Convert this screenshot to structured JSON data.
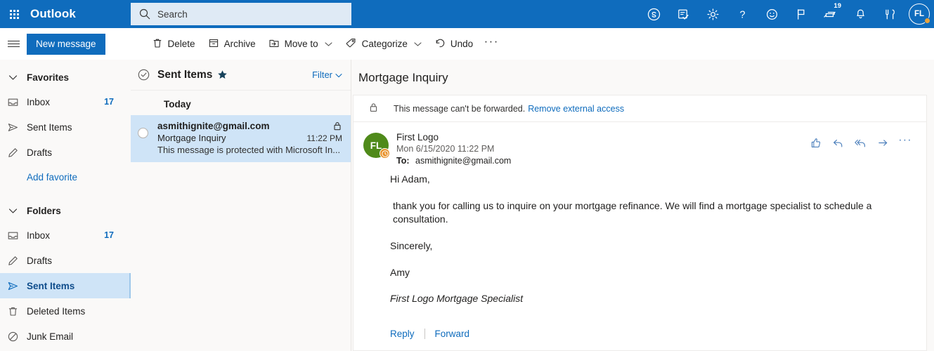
{
  "topbar": {
    "app_grid_icon": "waffle-icon",
    "brand": "Outlook",
    "search": {
      "icon": "search-icon",
      "placeholder": "Search",
      "value": ""
    },
    "icons": [
      {
        "name": "skype-icon",
        "label": "Skype"
      },
      {
        "name": "tasks-checklist-icon",
        "label": "To Do"
      },
      {
        "name": "gear-icon",
        "label": "Settings"
      },
      {
        "name": "question-mark-icon",
        "label": "Help"
      },
      {
        "name": "smiley-face-icon",
        "label": "Feedback"
      },
      {
        "name": "flag-icon",
        "label": "Flagged"
      },
      {
        "name": "chat-bubble-icon",
        "label": "Messages",
        "badge": "19"
      },
      {
        "name": "bell-icon",
        "label": "Notifications"
      },
      {
        "name": "utensils-icon",
        "label": "Lunch"
      }
    ],
    "message_badge": "19",
    "avatar_initials": "FL"
  },
  "commandbar": {
    "menu_icon": "hamburger-icon",
    "new_message": "New message",
    "actions": [
      {
        "label": "Delete",
        "icon": "trash-icon",
        "chevron": false
      },
      {
        "label": "Archive",
        "icon": "archive-box-icon",
        "chevron": false
      },
      {
        "label": "Move to",
        "icon": "move-to-folder-icon",
        "chevron": true
      },
      {
        "label": "Categorize",
        "icon": "tag-icon",
        "chevron": true
      },
      {
        "label": "Undo",
        "icon": "undo-arrow-icon",
        "chevron": false
      }
    ],
    "overflow": "···"
  },
  "sidebar": {
    "favorites": {
      "label": "Favorites",
      "chevron_icon": "chevron-down-icon",
      "items": [
        {
          "label": "Inbox",
          "icon": "inbox-icon",
          "count": "17"
        },
        {
          "label": "Sent Items",
          "icon": "sent-paper-plane-icon",
          "count": ""
        },
        {
          "label": "Drafts",
          "icon": "pencil-icon",
          "count": ""
        }
      ],
      "add_favorite": "Add favorite"
    },
    "folders": {
      "label": "Folders",
      "chevron_icon": "chevron-down-icon",
      "items": [
        {
          "label": "Inbox",
          "icon": "inbox-icon",
          "count": "17",
          "selected": false
        },
        {
          "label": "Drafts",
          "icon": "pencil-icon",
          "count": "",
          "selected": false
        },
        {
          "label": "Sent Items",
          "icon": "sent-paper-plane-icon",
          "count": "",
          "selected": true
        },
        {
          "label": "Deleted Items",
          "icon": "trash-icon",
          "count": "",
          "selected": false
        },
        {
          "label": "Junk Email",
          "icon": "no-entry-icon",
          "count": "",
          "selected": false
        }
      ]
    }
  },
  "messagelist": {
    "select_all_icon": "check-circle-icon",
    "title": "Sent Items",
    "star_icon": "star-filled-icon",
    "filter_label": "Filter",
    "filter_chevron": "chevron-down-icon",
    "day_group": "Today",
    "items": [
      {
        "sender": "asmithignite@gmail.com",
        "subject": "Mortgage Inquiry",
        "time": "11:22 PM",
        "preview": "This message is protected with Microsoft In...",
        "lock_icon": "lock-icon",
        "select_icon": "circle-icon",
        "selected": true
      }
    ]
  },
  "reading_pane": {
    "subject": "Mortgage Inquiry",
    "notice": {
      "icon": "lock-icon",
      "text": "This message can't be forwarded.",
      "link": "Remove external access"
    },
    "sender": {
      "avatar_initials": "FL",
      "avatar_color": "#4f8a1a",
      "badge_icon": "clock-icon",
      "badge_color": "#e8922b",
      "name": "First Logo",
      "date": "Mon 6/15/2020 11:22 PM",
      "to_label": "To:",
      "to_value": "asmithignite@gmail.com"
    },
    "actions": [
      {
        "name": "thumbs-up-icon",
        "label": "Like"
      },
      {
        "name": "reply-icon",
        "label": "Reply"
      },
      {
        "name": "reply-all-icon",
        "label": "Reply all"
      },
      {
        "name": "forward-arrow-icon",
        "label": "Forward"
      },
      {
        "name": "more-options-icon",
        "label": "···"
      }
    ],
    "body": [
      "Hi Adam,",
      " thank you for calling us to inquire on your mortgage refinance.  We will find a mortgage specialist to schedule a consultation.",
      "Sincerely,",
      "Amy"
    ],
    "signature": "First Logo Mortgage Specialist",
    "footer": {
      "reply": "Reply",
      "forward": "Forward"
    }
  },
  "colors": {
    "brand_blue": "#0f6cbd",
    "selection_blue": "#cfe4f7",
    "link_blue": "#0f6cbd",
    "avatar_green": "#4f8a1a",
    "badge_orange": "#e8922b"
  }
}
